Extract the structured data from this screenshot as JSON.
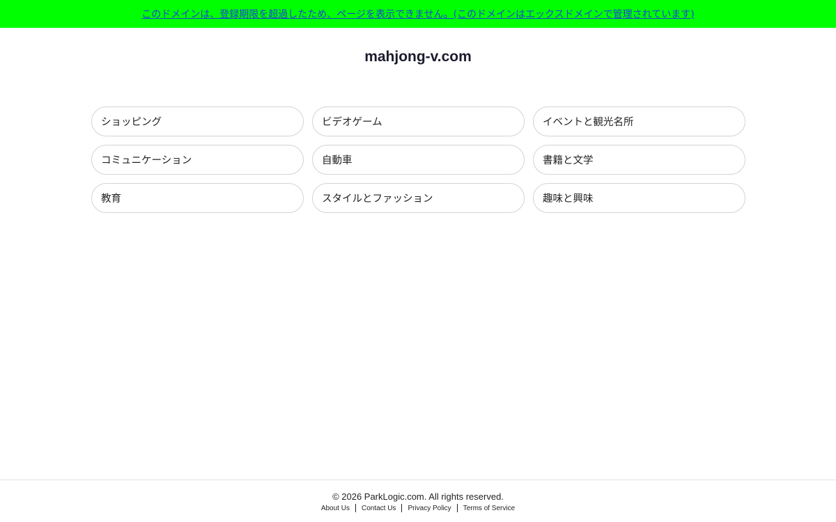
{
  "notice": {
    "text": "このドメインは、登録期限を超過したため、ページを表示できません。(このドメインはエックスドメインで管理されています)",
    "background_color": "#00ff00",
    "link_color": "#1a44d6"
  },
  "site": {
    "title": "mahjong-v.com"
  },
  "links": [
    {
      "label": "ショッピング"
    },
    {
      "label": "ビデオゲーム"
    },
    {
      "label": "イベントと観光名所"
    },
    {
      "label": "コミュニケーション"
    },
    {
      "label": "自動車"
    },
    {
      "label": "書籍と文学"
    },
    {
      "label": "教育"
    },
    {
      "label": "スタイルとファッション"
    },
    {
      "label": "趣味と興味"
    }
  ],
  "footer": {
    "copyright": "© 2026 ParkLogic.com. All rights reserved.",
    "about": "About Us",
    "contact": "Contact Us",
    "privacy": "Privacy Policy",
    "terms": "Terms of Service"
  }
}
